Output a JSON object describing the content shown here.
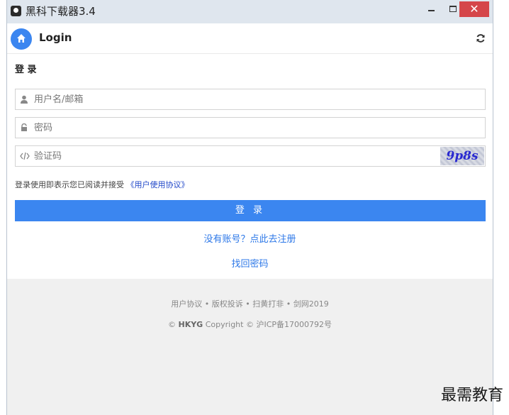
{
  "window": {
    "title": "黑科下载器3.4",
    "minimize_label": "",
    "maximize_label": "",
    "close_label": "✕"
  },
  "header": {
    "title": "Login"
  },
  "form": {
    "section_title": "登 录",
    "username_placeholder": "用户名/邮箱",
    "password_placeholder": "密码",
    "captcha_placeholder": "验证码",
    "captcha_text": "9p8s",
    "agreement_text": "登录使用即表示您已阅读并接受 ",
    "agreement_link": "《用户使用协议》",
    "login_button": "登 录",
    "register_link": "没有账号？点此去注册",
    "forgot_link": "找回密码"
  },
  "footer": {
    "links": "用户协议 • 版权投诉 • 扫黄打非 • 剑网2019",
    "copyright_prefix": "© ",
    "copyright_brand": "HKYG",
    "copyright_suffix": " Copyright © 沪ICP备17000792号"
  },
  "watermark": "最需教育",
  "colors": {
    "accent": "#3b86f0",
    "link": "#2d78e8",
    "close": "#d5464a"
  }
}
